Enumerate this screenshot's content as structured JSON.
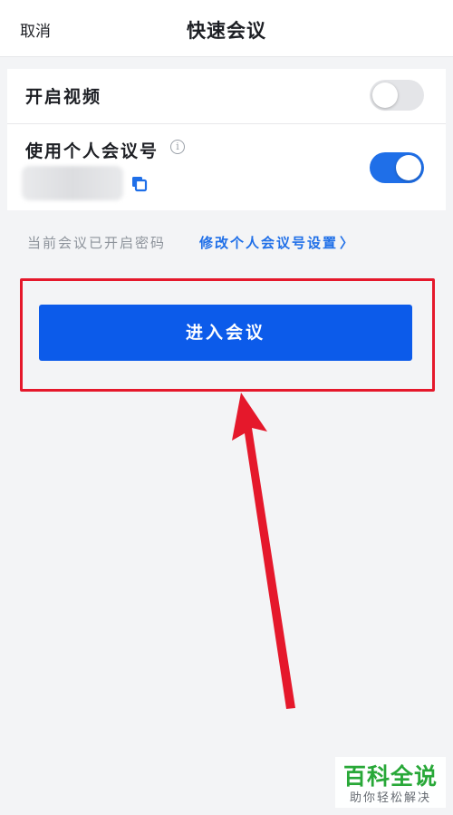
{
  "header": {
    "cancel_label": "取消",
    "title": "快速会议"
  },
  "settings": {
    "video": {
      "label": "开启视频",
      "enabled": false
    },
    "personal_meeting_id": {
      "label": "使用个人会议号",
      "info_icon": "info-icon",
      "copy_icon": "copy-icon",
      "enabled": true
    }
  },
  "password": {
    "status_text": "当前会议已开启密码",
    "link_text": "修改个人会议号设置",
    "link_chevron": "〉"
  },
  "join_button_label": "进入会议",
  "watermark": {
    "title": "百科全说",
    "subtitle": "助你轻松解决"
  },
  "colors": {
    "accent": "#1f6fe8",
    "button": "#0c5bea",
    "annotation": "#e5182b",
    "watermark": "#28a838"
  }
}
